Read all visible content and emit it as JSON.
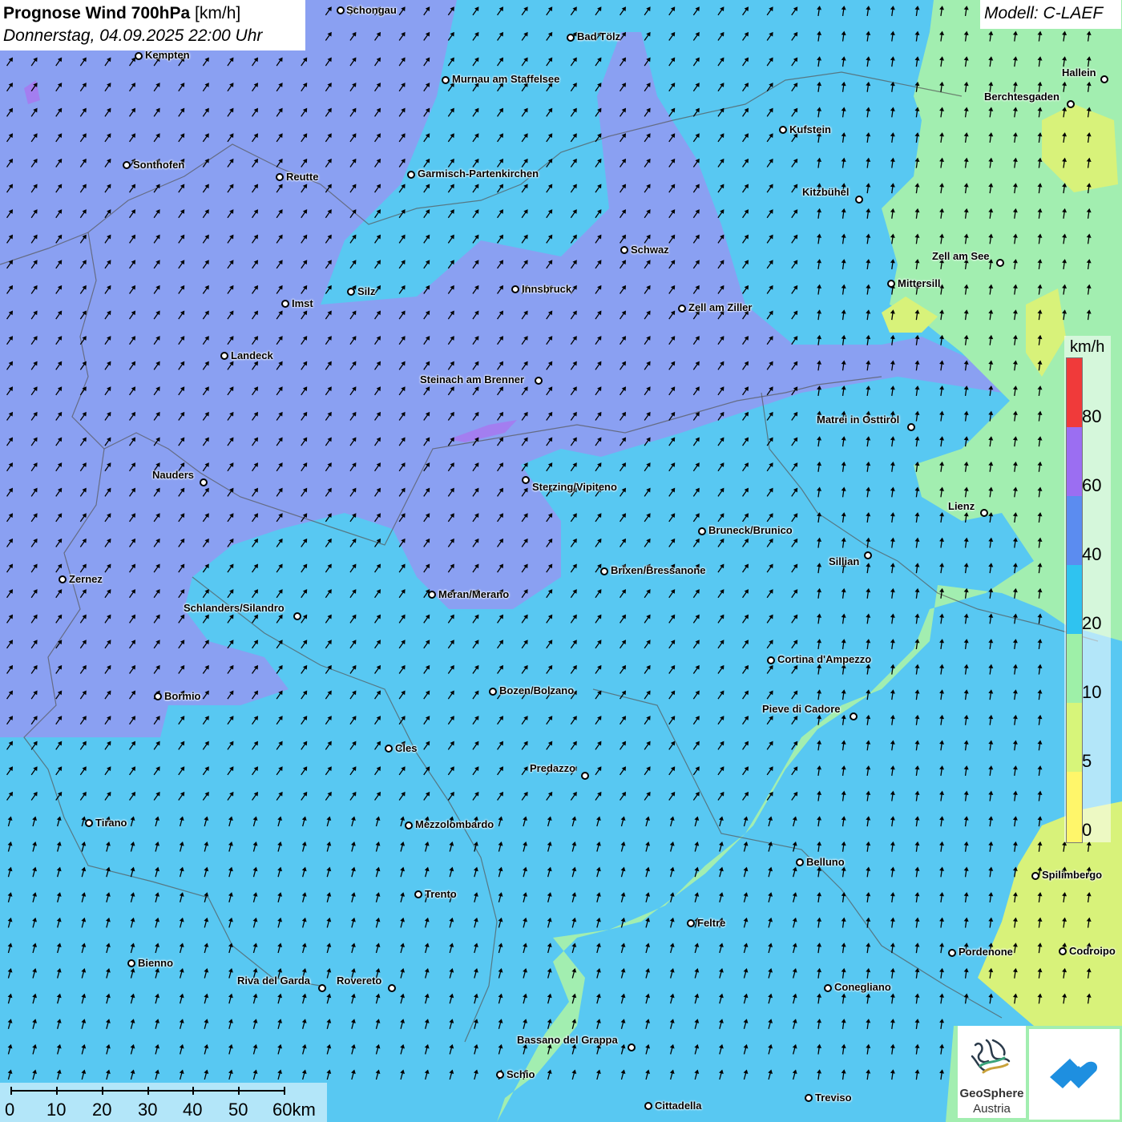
{
  "header": {
    "title_bold": "Prognose Wind 700hPa",
    "title_unit": "[km/h]",
    "datetime": "Donnerstag, 04.09.2025 22:00 Uhr",
    "model": "Modell: C-LAEF"
  },
  "legend": {
    "unit": "km/h",
    "ticks": [
      "0",
      "5",
      "10",
      "20",
      "40",
      "60",
      "80"
    ],
    "colors": [
      "#fff66a",
      "#d7f57a",
      "#9ef0a8",
      "#2fc3f0",
      "#5b8cf0",
      "#9b6ef2",
      "#f03a3a"
    ]
  },
  "scale": {
    "labels": [
      "0",
      "10",
      "20",
      "30",
      "40",
      "50",
      "60km"
    ]
  },
  "logos": {
    "geosphere_name": "GeoSphere",
    "geosphere_sub": "Austria",
    "geosphere_icon": "geosphere-logo-icon",
    "app_icon": "weather-app-icon"
  },
  "colors": {
    "strong_wind": "#8aa0f2",
    "moderate_wind": "#58c8f2",
    "light_wind": "#a2eeb0",
    "very_light_wind": "#d8f27a",
    "arrow": "#000000"
  },
  "cities": [
    {
      "name": "Schongau"
    },
    {
      "name": "Bad Tölz"
    },
    {
      "name": "Kempten"
    },
    {
      "name": "Murnau am Staffelsee"
    },
    {
      "name": "Hallein"
    },
    {
      "name": "Berchtesgaden"
    },
    {
      "name": "Kufstein"
    },
    {
      "name": "Sonthofen"
    },
    {
      "name": "Reutte"
    },
    {
      "name": "Garmisch-Partenkirchen"
    },
    {
      "name": "Kitzbühel"
    },
    {
      "name": "Schwaz"
    },
    {
      "name": "Zell am See"
    },
    {
      "name": "Innsbruck"
    },
    {
      "name": "Mittersill"
    },
    {
      "name": "Silz"
    },
    {
      "name": "Imst"
    },
    {
      "name": "Zell am Ziller"
    },
    {
      "name": "Landeck"
    },
    {
      "name": "Steinach am Brenner"
    },
    {
      "name": "Matrei in Osttirol"
    },
    {
      "name": "Nauders"
    },
    {
      "name": "Sterzing/Vipiteno"
    },
    {
      "name": "Lienz"
    },
    {
      "name": "Bruneck/Brunico"
    },
    {
      "name": "Sillian"
    },
    {
      "name": "Zernez"
    },
    {
      "name": "Brixen/Bressanone"
    },
    {
      "name": "Meran/Merano"
    },
    {
      "name": "Schlanders/Silandro"
    },
    {
      "name": "Cortina d'Ampezzo"
    },
    {
      "name": "Bozen/Bolzano"
    },
    {
      "name": "Bormio"
    },
    {
      "name": "Pieve di Cadore"
    },
    {
      "name": "Cles"
    },
    {
      "name": "Predazzo"
    },
    {
      "name": "Tirano"
    },
    {
      "name": "Mezzolombardo"
    },
    {
      "name": "Belluno"
    },
    {
      "name": "Spilimbergo"
    },
    {
      "name": "Trento"
    },
    {
      "name": "Feltre"
    },
    {
      "name": "Pordenone"
    },
    {
      "name": "Codroipo"
    },
    {
      "name": "Bienno"
    },
    {
      "name": "Riva del Garda"
    },
    {
      "name": "Rovereto"
    },
    {
      "name": "Conegliano"
    },
    {
      "name": "Bassano del Grappa"
    },
    {
      "name": "Schio"
    },
    {
      "name": "Treviso"
    },
    {
      "name": "Cittadella"
    }
  ]
}
